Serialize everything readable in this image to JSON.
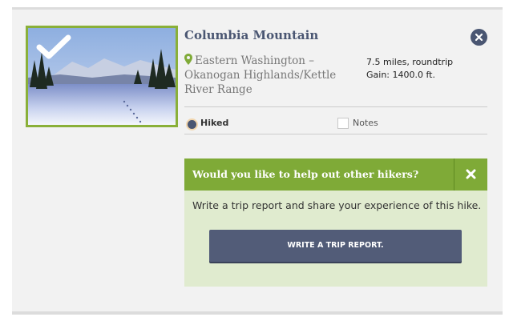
{
  "hike": {
    "title": "Columbia Mountain",
    "location": "Eastern Washington – Okanogan Highlands/Kettle River Range",
    "distance": "7.5 miles, roundtrip",
    "gain": "Gain: 1400.0 ft."
  },
  "status": {
    "hiked_label": "Hiked",
    "hiked_selected": true,
    "notes_label": "Notes",
    "notes_checked": false
  },
  "prompt": {
    "title": "Would you like to help out other hikers?",
    "body": "Write a trip report and share your experience of this hike.",
    "button_label": "WRITE A TRIP REPORT."
  },
  "icons": {
    "thumbnail_check": "checkmark-icon",
    "remove": "close-icon",
    "location": "map-pin-icon",
    "dismiss": "close-x-icon"
  },
  "colors": {
    "accent_green": "#7faa37",
    "slate": "#4a5672",
    "panel_bg": "#e0ebcf"
  }
}
